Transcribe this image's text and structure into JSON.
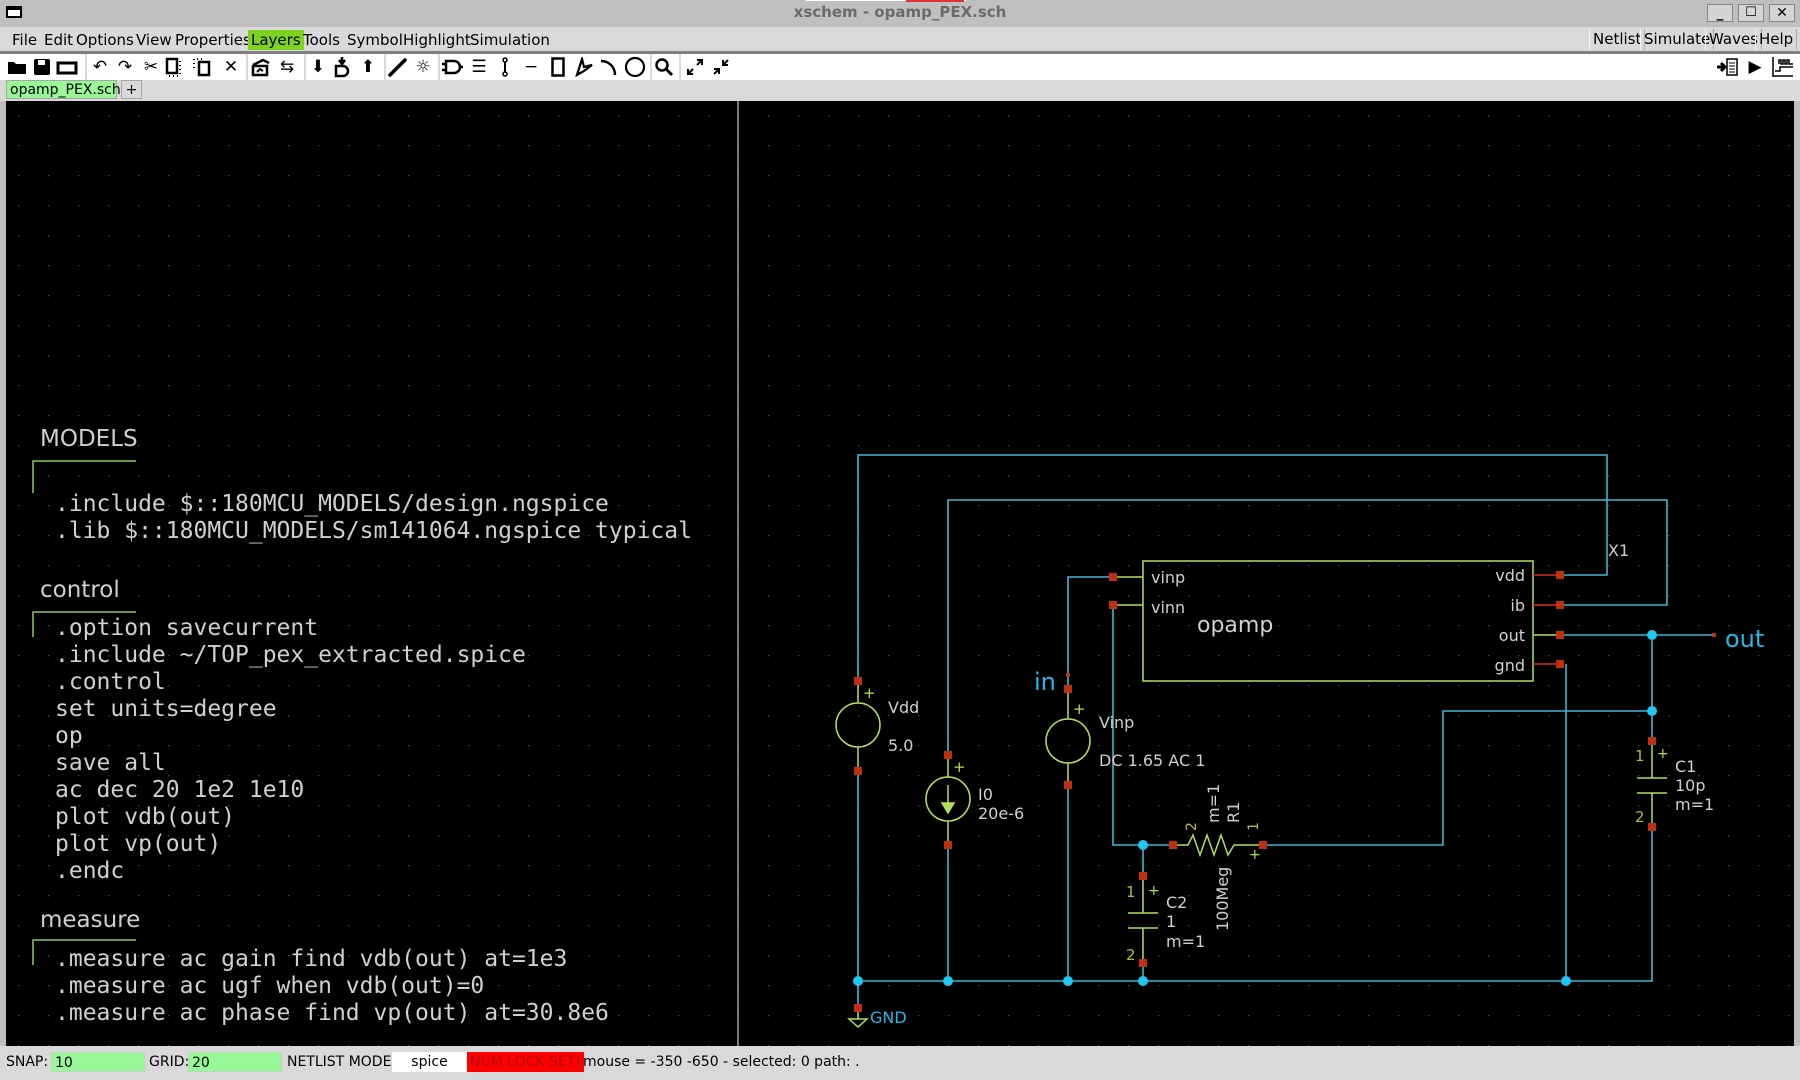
{
  "window": {
    "title": "xschem - opamp_PEX.sch",
    "minimize": "_",
    "maximize": "☐",
    "close": "✕"
  },
  "menu": {
    "left": [
      "File",
      "Edit",
      "Options",
      "View",
      "Properties",
      "Layers",
      "Tools",
      "Symbol",
      "Highlight",
      "Simulation"
    ],
    "active": "Layers",
    "right": [
      "Netlist",
      "Simulate",
      "Waves",
      "Help"
    ]
  },
  "toolbar": {
    "icons": [
      "open-icon",
      "save-icon",
      "reload-icon",
      "undo-icon",
      "redo-icon",
      "cut-icon",
      "copy-icon",
      "move-icon",
      "delete-icon",
      "place-symbol-icon",
      "swap-icon",
      "descend-icon",
      "descend-symbol-icon",
      "ascend-icon",
      "wire-icon",
      "highlight-icon",
      "symbol-icon",
      "text-icon",
      "pin-icon",
      "line-icon",
      "rect-icon",
      "polygon-icon",
      "arc-icon",
      "circle-icon",
      "zoom-icon",
      "zoom-out-icon",
      "zoom-in-icon"
    ],
    "right_icons": [
      "netlist-icon",
      "simulate-icon",
      "waves-icon"
    ]
  },
  "tabs": {
    "items": [
      "opamp_PEX.sch"
    ],
    "add": "+"
  },
  "code_blocks": [
    {
      "title": "MODELS",
      "lines": [
        "",
        ".include $::180MCU_MODELS/design.ngspice",
        ".lib $::180MCU_MODELS/sm141064.ngspice typical"
      ]
    },
    {
      "title": "control",
      "lines": [
        ".option savecurrent",
        ".include ~/TOP_pex_extracted.spice",
        ".control",
        "set units=degree",
        "op",
        "save all",
        "ac dec 20 1e2 1e10",
        "plot vdb(out)",
        "plot vp(out)",
        ".endc"
      ]
    },
    {
      "title": "measure",
      "lines": [
        ".measure ac gain find vdb(out) at=1e3",
        ".measure ac ugf when vdb(out)=0",
        ".measure ac phase find vp(out) at=30.8e6"
      ]
    }
  ],
  "schematic": {
    "opamp": {
      "name": "X1",
      "label": "opamp",
      "pins_left": [
        "vinp",
        "vinn"
      ],
      "pins_right": [
        "vdd",
        "ib",
        "out",
        "gnd"
      ]
    },
    "vdd": {
      "name": "Vdd",
      "value": "5.0"
    },
    "i0": {
      "name": "I0",
      "value": "20e-6"
    },
    "vinp": {
      "name": "Vinp",
      "value": "DC 1.65 AC 1"
    },
    "r1": {
      "name": "R1",
      "value": "100Meg",
      "mult": "m=1",
      "pin1": "1",
      "pin2": "2"
    },
    "c2": {
      "name": "C2",
      "value": "1",
      "mult": "m=1",
      "pin1": "1",
      "pin2": "2"
    },
    "c1": {
      "name": "C1",
      "value": "10p",
      "mult": "m=1",
      "pin1": "1",
      "pin2": "2"
    },
    "labels": {
      "in": "in",
      "out": "out",
      "gnd": "GND"
    },
    "plus": "+"
  },
  "colors": {
    "wire": "#3fb6d6",
    "symbol": "#b0e05a",
    "pin": "#c03010",
    "text": "#d0d0d0",
    "pin_number": "#b8b840",
    "net_label": "#1fb8e8",
    "grid": "#4a4a4a"
  },
  "status": {
    "snap_label": "SNAP:",
    "snap_value": "10",
    "grid_label": "GRID:",
    "grid_value": "20",
    "netlist_mode_label": "NETLIST MODE:",
    "netlist_mode_value": "spice",
    "numlock": "NUM LOCK SET!",
    "info": "mouse = -350 -650 - selected: 0 path: ."
  }
}
